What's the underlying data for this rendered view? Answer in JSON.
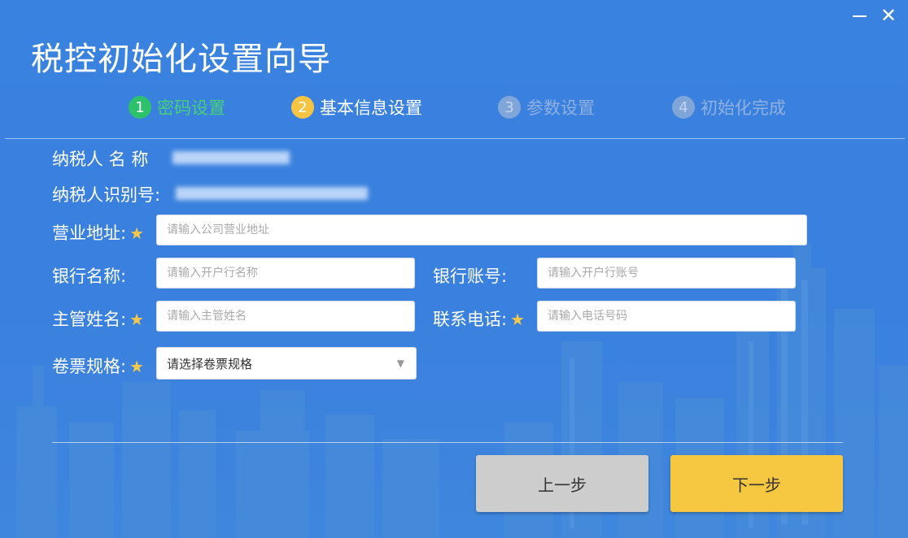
{
  "window": {
    "title": "税控初始化设置向导",
    "minimize_glyph": "",
    "close_glyph": "✕"
  },
  "steps": [
    {
      "num": "1",
      "label": "密码设置",
      "state": "done"
    },
    {
      "num": "2",
      "label": "基本信息设置",
      "state": "active"
    },
    {
      "num": "3",
      "label": "参数设置",
      "state": "future"
    },
    {
      "num": "4",
      "label": "初始化完成",
      "state": "future"
    }
  ],
  "info": {
    "taxpayer_name_label": "纳税人 名 称",
    "taxpayer_id_label": "纳税人识别号:"
  },
  "form": {
    "address_label": "营业地址:",
    "address_placeholder": "请输入公司营业地址",
    "bank_name_label": "银行名称:",
    "bank_name_placeholder": "请输入开户行名称",
    "bank_account_label": "银行账号:",
    "bank_account_placeholder": "请输入开户行账号",
    "supervisor_label": "主管姓名:",
    "supervisor_placeholder": "请输入主管姓名",
    "phone_label": "联系电话:",
    "phone_placeholder": "请输入电话号码",
    "roll_spec_label": "卷票规格:",
    "roll_spec_value": "请选择卷票规格",
    "required_mark": "★"
  },
  "buttons": {
    "prev": "上一步",
    "next": "下一步"
  },
  "colors": {
    "background": "#3a82e0",
    "step_done": "#2cc16a",
    "step_active": "#f5c443",
    "next_button": "#f6c740",
    "prev_button": "#cdcdcd"
  },
  "icons": {
    "minimize": "minimize-icon",
    "close": "close-icon",
    "dropdown": "chevron-down-icon"
  }
}
